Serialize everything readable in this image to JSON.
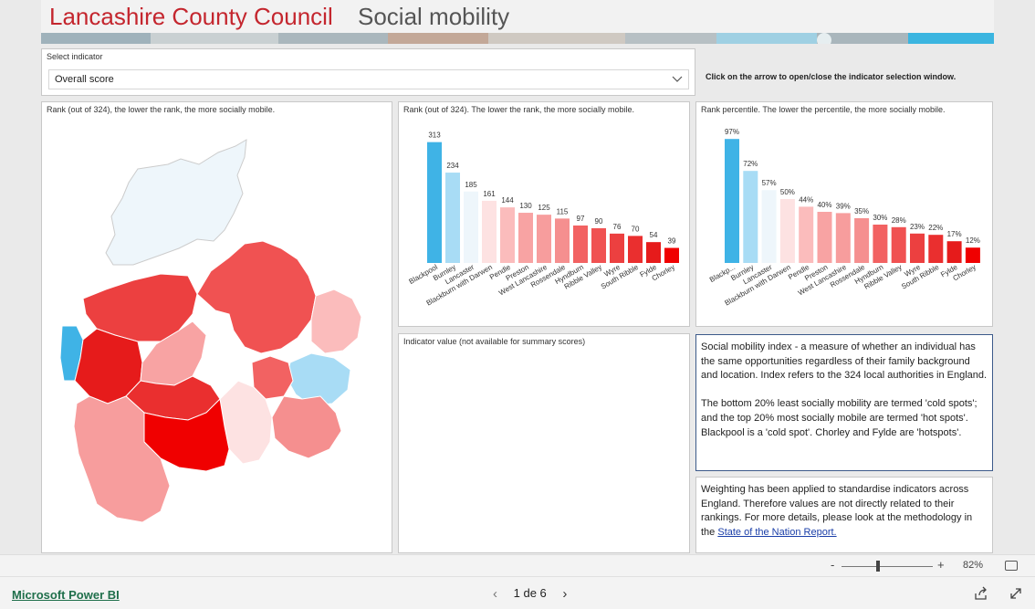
{
  "header": {
    "council": "Lancashire County Council",
    "title": "Social mobility"
  },
  "slicer": {
    "label": "Select indicator",
    "value": "Overall score"
  },
  "hint": "Click on the arrow to open/close the indicator selection window.",
  "map_panel": {
    "title": "Rank (out of 324), the lower the rank, the more socially mobile."
  },
  "bar1": {
    "title": "Rank (out of 324). The lower the rank, the more socially mobile."
  },
  "bar2": {
    "title": "Rank percentile. The lower the percentile, the more socially mobile."
  },
  "indicator_panel": {
    "title": "Indicator value (not available for summary scores)"
  },
  "text1": {
    "para1": "Social mobility index - a measure of whether an individual has the same opportunities regardless of their family background and location. Index refers to the 324 local authorities in England.",
    "para2": "The bottom 20% least socially mobility are termed 'cold spots'; and the top 20% most socially mobile are termed 'hot spots'. Blackpool is a 'cold spot'. Chorley and Fylde are 'hotspots'."
  },
  "text2": {
    "body": "Weighting has been applied to standardise indicators across England. Therefore values are not directly related to their rankings. For more details, please look at the methodology in the ",
    "link": "State of the Nation Report."
  },
  "colors": [
    "#3fb3e6",
    "#a8dcf5",
    "#eef6fb",
    "#fde2e2",
    "#fbbcbc",
    "#f8a3a3",
    "#f79d9d",
    "#f58f8f",
    "#f26262",
    "#f05252",
    "#ec4040",
    "#ea2f2f",
    "#e61b1b",
    "#f00000"
  ],
  "chart_data": [
    {
      "type": "bar",
      "categories": [
        "Blackpool",
        "Burnley",
        "Lancaster",
        "Blackburn with Darwen",
        "Pendle",
        "Preston",
        "West Lancashire",
        "Rossendale",
        "Hyndburn",
        "Ribble Valley",
        "Wyre",
        "South Ribble",
        "Fylde",
        "Chorley"
      ],
      "values": [
        313,
        234,
        185,
        161,
        144,
        130,
        125,
        115,
        97,
        90,
        76,
        70,
        54,
        39
      ],
      "data_labels": [
        "313",
        "234",
        "185",
        "161",
        "144",
        "130",
        "125",
        "115",
        "97",
        "90",
        "76",
        "70",
        "54",
        "39"
      ],
      "ylim": [
        0,
        324
      ],
      "grid": false
    },
    {
      "type": "bar",
      "categories": [
        "Blackp...",
        "Burnley",
        "Lancaster",
        "Blackburn with Darwen",
        "Pendle",
        "Preston",
        "West Lancashire",
        "Rossendale",
        "Hyndburn",
        "Ribble Valley",
        "Wyre",
        "South Ribble",
        "Fylde",
        "Chorley"
      ],
      "values": [
        97,
        72,
        57,
        50,
        44,
        40,
        39,
        35,
        30,
        28,
        23,
        22,
        17,
        12
      ],
      "data_labels": [
        "97%",
        "72%",
        "57%",
        "50%",
        "44%",
        "40%",
        "39%",
        "35%",
        "30%",
        "28%",
        "23%",
        "22%",
        "17%",
        "12%"
      ],
      "ylim": [
        0,
        100
      ],
      "grid": false
    }
  ],
  "footer": {
    "brand": "Microsoft Power BI",
    "page": "1 de 6",
    "zoom": "82%"
  }
}
